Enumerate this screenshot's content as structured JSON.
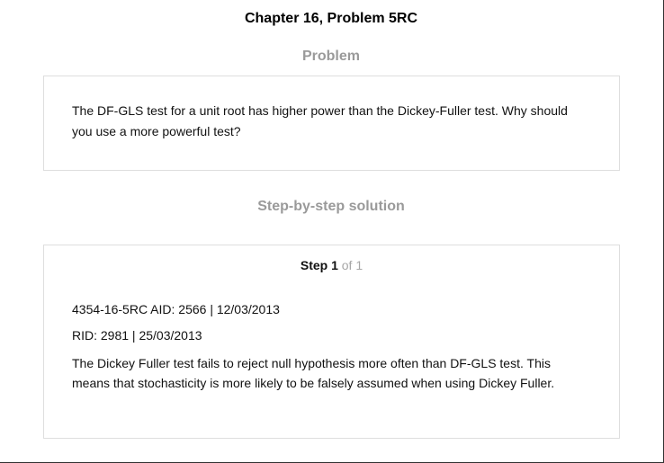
{
  "page": {
    "title": "Chapter 16, Problem 5RC"
  },
  "problem": {
    "heading": "Problem",
    "text": "The DF-GLS test for a unit root has higher power than the Dickey-Fuller test. Why should you use a more powerful test?"
  },
  "solution": {
    "heading": "Step-by-step solution",
    "step": {
      "label": "Step 1",
      "of_text": "of 1"
    },
    "lines": [
      "4354-16-5RC AID: 2566 | 12/03/2013",
      "RID: 2981 | 25/03/2013",
      "The Dickey Fuller test fails to reject null hypothesis more often than DF-GLS test. This means that stochasticity is more likely to be falsely assumed when using Dickey Fuller."
    ]
  }
}
